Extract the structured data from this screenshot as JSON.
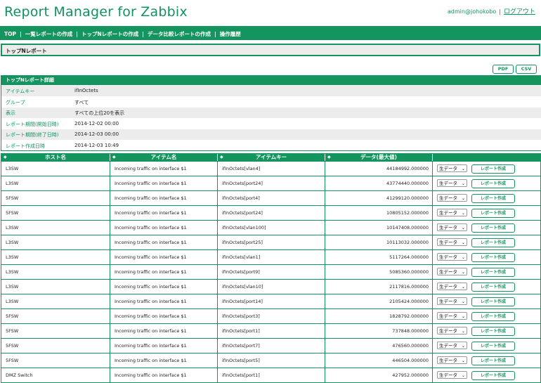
{
  "header": {
    "logo": "Report Manager for Zabbix",
    "user": "admin@johokobo",
    "separator": "|",
    "logout": "ログアウト"
  },
  "nav": {
    "items": [
      "TOP",
      "一覧レポートの作成",
      "トップNレポートの作成",
      "データ比較レポートの作成",
      "操作履歴"
    ],
    "separator": "|"
  },
  "page_title": "トップNレポート",
  "buttons": {
    "pdf": "PDF",
    "csv": "CSV"
  },
  "detail": {
    "title": "トップNレポート詳細",
    "rows": [
      {
        "label": "アイテムキー",
        "value": "ifInOctets"
      },
      {
        "label": "グループ",
        "value": "すべて"
      },
      {
        "label": "表示",
        "value": "すべての上位20を表示"
      },
      {
        "label": "レポート期間(開始日時)",
        "value": "2014-12-02 00:00"
      },
      {
        "label": "レポート期間(終了日時)",
        "value": "2014-12-03 00:00"
      },
      {
        "label": "レポート作成日時",
        "value": "2014-12-03 10:49"
      }
    ]
  },
  "table": {
    "headers": [
      "ホスト名",
      "アイテム名",
      "アイテムキー",
      "データ(最大値)",
      ""
    ],
    "sort_arrow": "◆",
    "select_label": "生データ",
    "select_arrow": "⌄",
    "create_label": "レポート作成",
    "rows": [
      {
        "host": "L3SW",
        "item": "Incoming traffic on interface $1",
        "key": "ifInOctets[vlan4]",
        "value": "44184992.000000"
      },
      {
        "host": "L3SW",
        "item": "Incoming traffic on interface $1",
        "key": "ifInOctets[port24]",
        "value": "43774440.000000"
      },
      {
        "host": "5FSW",
        "item": "Incoming traffic on interface $1",
        "key": "ifInOctets[port4]",
        "value": "41299120.000000"
      },
      {
        "host": "5FSW",
        "item": "Incoming traffic on interface $1",
        "key": "ifInOctets[port24]",
        "value": "10805152.000000"
      },
      {
        "host": "L3SW",
        "item": "Incoming traffic on interface $1",
        "key": "ifInOctets[vlan100]",
        "value": "10147408.000000"
      },
      {
        "host": "L3SW",
        "item": "Incoming traffic on interface $1",
        "key": "ifInOctets[port25]",
        "value": "10113032.000000"
      },
      {
        "host": "L3SW",
        "item": "Incoming traffic on interface $1",
        "key": "ifInOctets[vlan1]",
        "value": "5117264.000000"
      },
      {
        "host": "L3SW",
        "item": "Incoming traffic on interface $1",
        "key": "ifInOctets[port9]",
        "value": "5085360.000000"
      },
      {
        "host": "L3SW",
        "item": "Incoming traffic on interface $1",
        "key": "ifInOctets[vlan10]",
        "value": "2117816.000000"
      },
      {
        "host": "L3SW",
        "item": "Incoming traffic on interface $1",
        "key": "ifInOctets[port14]",
        "value": "2105424.000000"
      },
      {
        "host": "5FSW",
        "item": "Incoming traffic on interface $1",
        "key": "ifInOctets[port3]",
        "value": "1828792.000000"
      },
      {
        "host": "5FSW",
        "item": "Incoming traffic on interface $1",
        "key": "ifInOctets[port1]",
        "value": "737848.000000"
      },
      {
        "host": "5FSW",
        "item": "Incoming traffic on interface $1",
        "key": "ifInOctets[port7]",
        "value": "476560.000000"
      },
      {
        "host": "5FSW",
        "item": "Incoming traffic on interface $1",
        "key": "ifInOctets[port5]",
        "value": "446504.000000"
      },
      {
        "host": "DMZ Switch",
        "item": "Incoming traffic on interface $1",
        "key": "ifInOctets[port1]",
        "value": "427952.000000"
      }
    ]
  }
}
